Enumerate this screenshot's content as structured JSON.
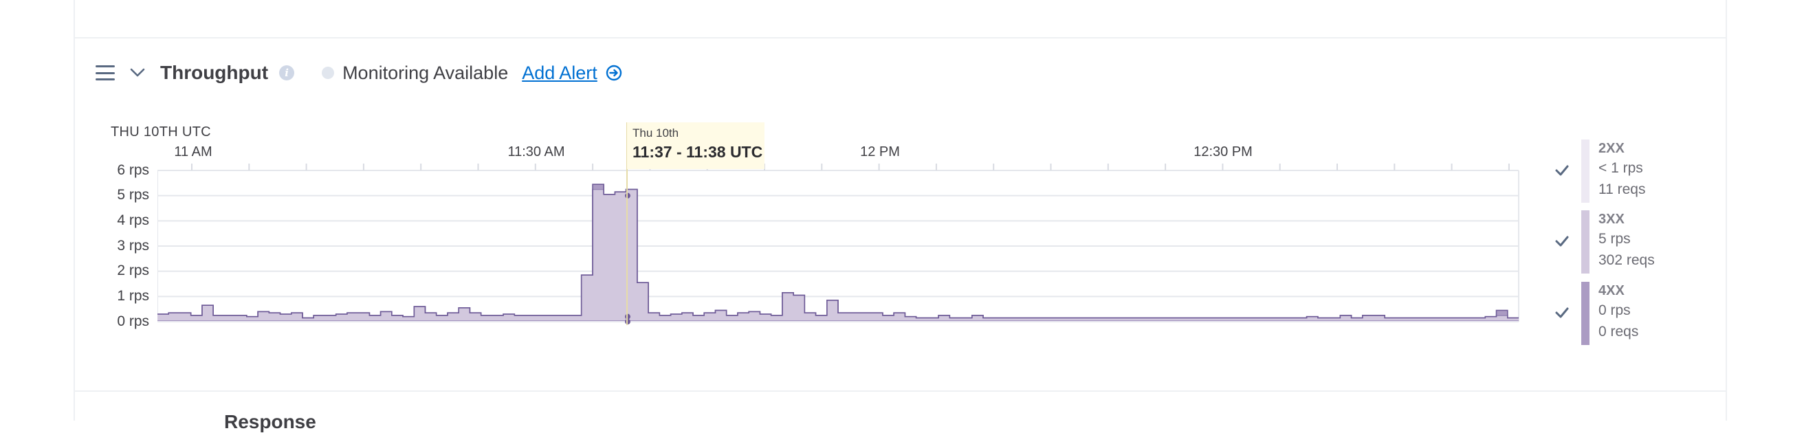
{
  "metric": {
    "title": "Throughput",
    "info_icon": "i",
    "status_text": "Monitoring Available",
    "add_alert_label": "Add Alert"
  },
  "chart": {
    "date_caption": "THU 10TH UTC",
    "time_labels": [
      "11 AM",
      "11:30 AM",
      "12 PM",
      "12:30 PM"
    ],
    "y_ticks": [
      "6 rps",
      "5 rps",
      "4 rps",
      "3 rps",
      "2 rps",
      "1 rps",
      "0 rps"
    ],
    "tooltip": {
      "day": "Thu 10th",
      "range": "11:37 - 11:38 UTC"
    }
  },
  "legend": [
    {
      "code": "2XX",
      "rate": "< 1 rps",
      "reqs": "11 reqs",
      "color": "#ede9f3"
    },
    {
      "code": "3XX",
      "rate": "5 rps",
      "reqs": "302 reqs",
      "color": "#d2c8de"
    },
    {
      "code": "4XX",
      "rate": "0 rps",
      "reqs": "0 reqs",
      "color": "#ab9bc3"
    }
  ],
  "next_metric": {
    "title": "Response"
  },
  "chart_data": {
    "type": "area",
    "title": "Throughput",
    "date": "THU 10TH UTC",
    "time_range": [
      "10:58",
      "13:00"
    ],
    "x_tick_labels": [
      "11 AM",
      "11:30 AM",
      "12 PM",
      "12:30 PM"
    ],
    "ylabel": "",
    "ylim": [
      0,
      6
    ],
    "y_tick_labels": [
      "0 rps",
      "1 rps",
      "2 rps",
      "3 rps",
      "4 rps",
      "5 rps",
      "6 rps"
    ],
    "grid": true,
    "legend_position": "right",
    "highlighted_interval": "11:37 - 11:38 UTC",
    "series": [
      {
        "name": "2XX",
        "color": "#ede9f3",
        "values": [
          0.05,
          0.05,
          0.05,
          0.05,
          0.05,
          0.05,
          0.05,
          0.05,
          0.05,
          0.05,
          0.05,
          0.05,
          0.05,
          0.05,
          0.05,
          0.05,
          0.05,
          0.05,
          0.05,
          0.05,
          0.05,
          0.05,
          0.05,
          0.05,
          0.05,
          0.05,
          0.05,
          0.05,
          0.05,
          0.05,
          0.05,
          0.05,
          0.05,
          0.05,
          0.05,
          0.05,
          0.05,
          0.05,
          0.05,
          0.05,
          0.05,
          0.05,
          0.05,
          0.05,
          0.05,
          0.05,
          0.05,
          0.05,
          0.05,
          0.05,
          0.05,
          0.05,
          0.05,
          0.05,
          0.05,
          0.05,
          0.05,
          0.05,
          0.05,
          0.05,
          0.05,
          0.05,
          0.05,
          0.05,
          0.05,
          0.05,
          0.05,
          0.05,
          0.05,
          0.05,
          0.05,
          0.05,
          0.05,
          0.05,
          0.05,
          0.05,
          0.05,
          0.05,
          0.05,
          0.05,
          0.05,
          0.05,
          0.05,
          0.05,
          0.05,
          0.05,
          0.05,
          0.05,
          0.05,
          0.05,
          0.05,
          0.05,
          0.05,
          0.05,
          0.05,
          0.05,
          0.05,
          0.05,
          0.05,
          0.05,
          0.05,
          0.05,
          0.05,
          0.05,
          0.05,
          0.05,
          0.05,
          0.05,
          0.05,
          0.05,
          0.05,
          0.05,
          0.05,
          0.05,
          0.05,
          0.05,
          0.05,
          0.05,
          0.05,
          0.05,
          0.05,
          0.05
        ]
      },
      {
        "name": "3XX",
        "color": "#d2c8de",
        "values": [
          0.25,
          0.3,
          0.3,
          0.2,
          0.6,
          0.2,
          0.2,
          0.2,
          0.15,
          0.35,
          0.3,
          0.25,
          0.3,
          0.1,
          0.2,
          0.2,
          0.25,
          0.3,
          0.3,
          0.2,
          0.35,
          0.2,
          0.15,
          0.55,
          0.3,
          0.2,
          0.3,
          0.5,
          0.3,
          0.2,
          0.2,
          0.25,
          0.2,
          0.2,
          0.2,
          0.2,
          0.2,
          0.2,
          1.8,
          5.2,
          5.0,
          5.1,
          5.2,
          1.5,
          0.3,
          0.2,
          0.25,
          0.3,
          0.2,
          0.3,
          0.4,
          0.2,
          0.3,
          0.35,
          0.25,
          0.2,
          1.1,
          1.0,
          0.3,
          0.2,
          0.8,
          0.3,
          0.3,
          0.3,
          0.3,
          0.2,
          0.3,
          0.15,
          0.1,
          0.1,
          0.2,
          0.1,
          0.1,
          0.2,
          0.1,
          0.1,
          0.1,
          0.1,
          0.1,
          0.1,
          0.1,
          0.1,
          0.1,
          0.1,
          0.1,
          0.1,
          0.1,
          0.1,
          0.1,
          0.1,
          0.1,
          0.1,
          0.1,
          0.1,
          0.1,
          0.1,
          0.1,
          0.1,
          0.1,
          0.1,
          0.1,
          0.1,
          0.1,
          0.15,
          0.1,
          0.1,
          0.2,
          0.1,
          0.2,
          0.2,
          0.1,
          0.1,
          0.1,
          0.1,
          0.1,
          0.1,
          0.1,
          0.1,
          0.1,
          0.15,
          0.2,
          0.1
        ]
      },
      {
        "name": "4XX",
        "color": "#ab9bc3",
        "values": [
          0,
          0,
          0,
          0,
          0,
          0,
          0,
          0,
          0,
          0,
          0,
          0,
          0,
          0,
          0,
          0,
          0,
          0,
          0,
          0,
          0,
          0,
          0,
          0,
          0,
          0,
          0,
          0,
          0,
          0,
          0,
          0,
          0,
          0,
          0,
          0,
          0,
          0,
          0,
          0.2,
          0,
          0,
          0,
          0,
          0,
          0,
          0,
          0,
          0,
          0,
          0,
          0,
          0,
          0,
          0,
          0,
          0,
          0,
          0,
          0,
          0,
          0,
          0,
          0,
          0,
          0,
          0,
          0,
          0,
          0,
          0,
          0,
          0,
          0,
          0,
          0,
          0,
          0,
          0,
          0,
          0,
          0,
          0,
          0,
          0,
          0,
          0,
          0,
          0,
          0,
          0,
          0,
          0,
          0,
          0,
          0,
          0,
          0,
          0,
          0,
          0,
          0,
          0,
          0,
          0,
          0,
          0,
          0,
          0,
          0,
          0,
          0,
          0,
          0,
          0,
          0,
          0,
          0,
          0,
          0,
          0.2,
          0
        ]
      }
    ]
  }
}
